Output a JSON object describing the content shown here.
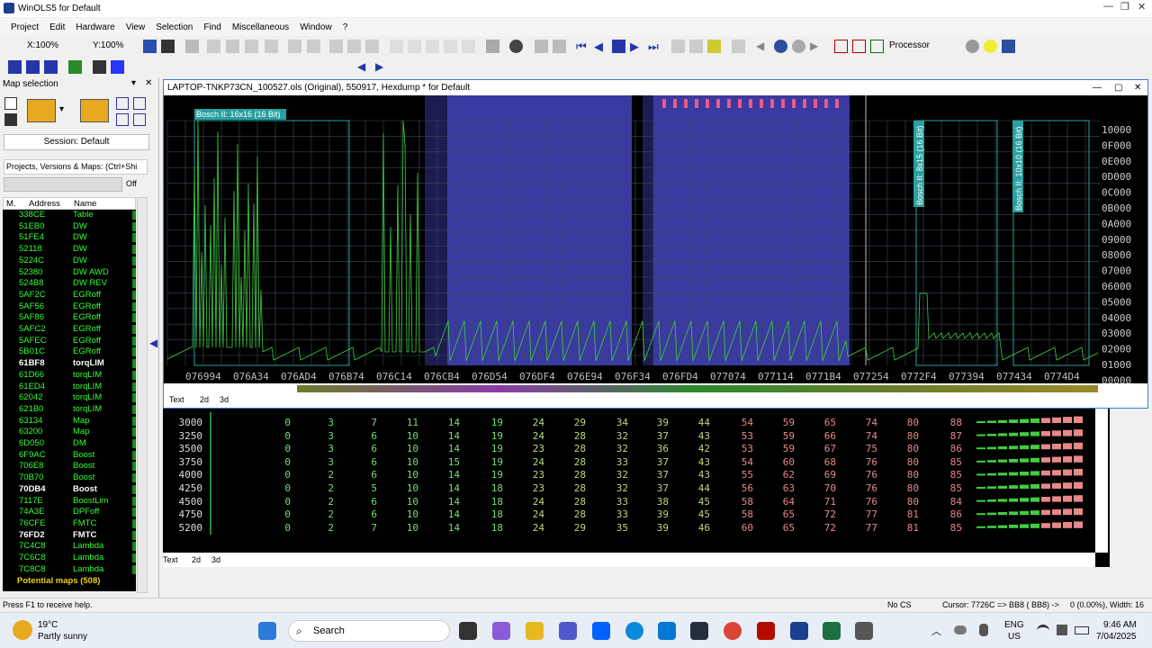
{
  "app": {
    "title": "WinOLS5 for Default"
  },
  "menu": [
    "Project",
    "Edit",
    "Hardware",
    "View",
    "Selection",
    "Find",
    "Miscellaneous",
    "Window",
    "?"
  ],
  "toolbar": {
    "zoom_x": "X:100%",
    "zoom_y": "Y:100%",
    "processor": "Processor"
  },
  "left": {
    "title": "Map selection",
    "session": "Session: Default",
    "projects_label": "Projects, Versions & Maps: (Ctrl+Shi",
    "off": "Off",
    "col_m": "M.",
    "col_address": "Address",
    "col_name": "Name",
    "rows": [
      {
        "a": "338CE",
        "n": "Table",
        "b": false
      },
      {
        "a": "51EB0",
        "n": "DW",
        "b": false
      },
      {
        "a": "51FE4",
        "n": "DW",
        "b": false
      },
      {
        "a": "52118",
        "n": "DW",
        "b": false
      },
      {
        "a": "5224C",
        "n": "DW",
        "b": false
      },
      {
        "a": "52380",
        "n": "DW AWD",
        "b": false
      },
      {
        "a": "524B8",
        "n": "DW REV",
        "b": false
      },
      {
        "a": "5AF2C",
        "n": "EGRoff",
        "b": false
      },
      {
        "a": "5AF56",
        "n": "EGRoff",
        "b": false
      },
      {
        "a": "5AF86",
        "n": "EGRoff",
        "b": false
      },
      {
        "a": "5AFC2",
        "n": "EGRoff",
        "b": false
      },
      {
        "a": "5AFEC",
        "n": "EGRoff",
        "b": false
      },
      {
        "a": "5B01C",
        "n": "EGRoff",
        "b": false
      },
      {
        "a": "61BF8",
        "n": "torqLIM",
        "b": true
      },
      {
        "a": "61D66",
        "n": "torqLIM",
        "b": false
      },
      {
        "a": "61ED4",
        "n": "torqLIM",
        "b": false
      },
      {
        "a": "62042",
        "n": "torqLIM",
        "b": false
      },
      {
        "a": "621B0",
        "n": "torqLIM",
        "b": false
      },
      {
        "a": "63134",
        "n": "Map",
        "b": false
      },
      {
        "a": "63200",
        "n": "Map",
        "b": false
      },
      {
        "a": "6D050",
        "n": "DM",
        "b": false
      },
      {
        "a": "6F9AC",
        "n": "Boost",
        "b": false
      },
      {
        "a": "706E8",
        "n": "Boost",
        "b": false
      },
      {
        "a": "70B70",
        "n": "Boost",
        "b": false
      },
      {
        "a": "70DB4",
        "n": "Boost",
        "b": true
      },
      {
        "a": "7117E",
        "n": "BoostLim",
        "b": false
      },
      {
        "a": "74A3E",
        "n": "DPFoff",
        "b": false
      },
      {
        "a": "76CFE",
        "n": "FMTC",
        "b": false
      },
      {
        "a": "76FD2",
        "n": "FMTC",
        "b": true
      },
      {
        "a": "7C4C8",
        "n": "Lambda",
        "b": false
      },
      {
        "a": "7C6C8",
        "n": "Lambda",
        "b": false
      },
      {
        "a": "7C8C8",
        "n": "Lambda",
        "b": false
      }
    ],
    "potential": "Potential maps (508)"
  },
  "hex": {
    "title": "LAPTOP-TNKP73CN_100527.ols (Original), 550917, Hexdump * for Default",
    "map_labels": [
      "Bosch II: 16x16 (16 Bit)",
      "Bosch II: 8x15 (16 Bit)",
      "Bosch II: 10x10 (16 Bit)"
    ],
    "x_labels": [
      "076994",
      "076A34",
      "076AD4",
      "076B74",
      "076C14",
      "076CB4",
      "076D54",
      "076DF4",
      "076E94",
      "076F34",
      "076FD4",
      "077074",
      "077114",
      "0771B4",
      "077254",
      "0772F4",
      "077394",
      "077434",
      "0774D4"
    ],
    "y_labels": [
      "10000",
      "0F000",
      "0E000",
      "0D000",
      "0C000",
      "0B000",
      "0A000",
      "09000",
      "08000",
      "07000",
      "06000",
      "05000",
      "04000",
      "03000",
      "02000",
      "01000",
      "00000"
    ],
    "tabs": [
      "Text",
      "2d",
      "3d"
    ]
  },
  "table": {
    "rows": [
      [
        "3000",
        "0",
        "3",
        "7",
        "11",
        "14",
        "19",
        "24",
        "29",
        "34",
        "39",
        "44",
        "54",
        "59",
        "65",
        "74",
        "80",
        "88"
      ],
      [
        "3250",
        "0",
        "3",
        "6",
        "10",
        "14",
        "19",
        "24",
        "28",
        "32",
        "37",
        "43",
        "53",
        "59",
        "66",
        "74",
        "80",
        "87"
      ],
      [
        "3500",
        "0",
        "3",
        "6",
        "10",
        "14",
        "19",
        "23",
        "28",
        "32",
        "36",
        "42",
        "53",
        "59",
        "67",
        "75",
        "80",
        "86"
      ],
      [
        "3750",
        "0",
        "3",
        "6",
        "10",
        "15",
        "19",
        "24",
        "28",
        "33",
        "37",
        "43",
        "54",
        "60",
        "68",
        "76",
        "80",
        "85"
      ],
      [
        "4000",
        "0",
        "2",
        "6",
        "10",
        "14",
        "19",
        "23",
        "28",
        "32",
        "37",
        "43",
        "55",
        "62",
        "69",
        "76",
        "80",
        "85"
      ],
      [
        "4250",
        "0",
        "2",
        "5",
        "10",
        "14",
        "18",
        "23",
        "28",
        "32",
        "37",
        "44",
        "56",
        "63",
        "70",
        "76",
        "80",
        "85"
      ],
      [
        "4500",
        "0",
        "2",
        "6",
        "10",
        "14",
        "18",
        "24",
        "28",
        "33",
        "38",
        "45",
        "58",
        "64",
        "71",
        "76",
        "80",
        "84"
      ],
      [
        "4750",
        "0",
        "2",
        "6",
        "10",
        "14",
        "18",
        "24",
        "28",
        "33",
        "39",
        "45",
        "58",
        "65",
        "72",
        "77",
        "81",
        "86"
      ],
      [
        "5200",
        "0",
        "2",
        "7",
        "10",
        "14",
        "18",
        "24",
        "29",
        "35",
        "39",
        "46",
        "60",
        "65",
        "72",
        "77",
        "81",
        "85"
      ]
    ],
    "tabs": [
      "Text",
      "2d",
      "3d"
    ]
  },
  "status": {
    "help": "Press F1 to receive help.",
    "cs": "No CS",
    "cursor": "Cursor: 7726C => BB8 ( BB8) ->",
    "sel": "0 (0.00%), Width: 16"
  },
  "taskbar": {
    "temp": "19°C",
    "weather": "Partly sunny",
    "search": "Search",
    "lang1": "ENG",
    "lang2": "US",
    "time": "9:46 AM",
    "date": "7/04/2025"
  }
}
